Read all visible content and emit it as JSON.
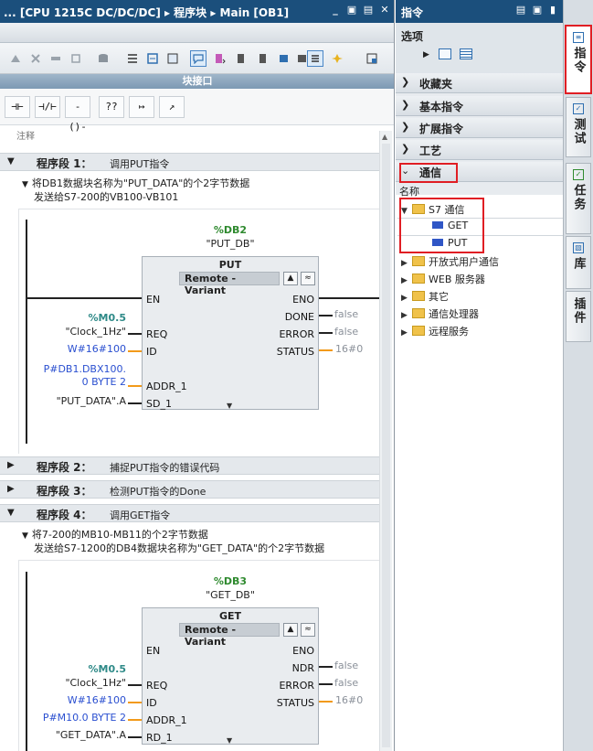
{
  "editor": {
    "title": "... [CPU 1215C DC/DC/DC] ▸ 程序块 ▸ Main [OB1]",
    "interface_label": "块接口",
    "comment_label": "注释",
    "ladder_buttons": [
      "⊣⊢",
      "⊣/⊢",
      "-()-",
      "??",
      "↦",
      "↗"
    ],
    "networks": [
      {
        "num": "程序段 1：",
        "title": "调用PUT指令",
        "expanded": true,
        "comment_line1": "将DB1数据块名称为\"PUT_DATA\"的个2字节数据",
        "comment_line2": "发送给S7-200的VB100-VB101"
      },
      {
        "num": "程序段 2：",
        "title": "捕捉PUT指令的错误代码",
        "expanded": false
      },
      {
        "num": "程序段 3：",
        "title": "检测PUT指令的Done",
        "expanded": false
      },
      {
        "num": "程序段 4：",
        "title": "调用GET指令",
        "expanded": true,
        "comment_line1": "将7-200的MB10-MB11的个2字节数据",
        "comment_line2": "发送给S7-1200的DB4数据块名称为\"GET_DATA\"的个2字节数据"
      }
    ],
    "put_block": {
      "db": "%DB2",
      "instance": "\"PUT_DB\"",
      "name": "PUT",
      "variant": "Remote - Variant",
      "pins_left": [
        "EN",
        "REQ",
        "ID",
        "ADDR_1",
        "SD_1"
      ],
      "pins_right": [
        "ENO",
        "DONE",
        "ERROR",
        "STATUS"
      ],
      "req_addr": "%M0.5",
      "req_tag": "\"Clock_1Hz\"",
      "id_val": "W#16#100",
      "addr_line1": "P#DB1.DBX100.",
      "addr_line2": "0 BYTE 2",
      "sd_val": "\"PUT_DATA\".A",
      "done_val": "false",
      "error_val": "false",
      "status_val": "16#0"
    },
    "get_block": {
      "db": "%DB3",
      "instance": "\"GET_DB\"",
      "name": "GET",
      "variant": "Remote - Variant",
      "pins_left": [
        "EN",
        "REQ",
        "ID",
        "ADDR_1",
        "RD_1"
      ],
      "pins_right": [
        "ENO",
        "NDR",
        "ERROR",
        "STATUS"
      ],
      "req_addr": "%M0.5",
      "req_tag": "\"Clock_1Hz\"",
      "id_val": "W#16#100",
      "addr_val": "P#M10.0 BYTE 2",
      "rd_val": "\"GET_DATA\".A",
      "ndr_val": "false",
      "error_val": "false",
      "status_val": "16#0"
    }
  },
  "instructions": {
    "title": "指令",
    "options_label": "选项",
    "sections": [
      "收藏夹",
      "基本指令",
      "扩展指令",
      "工艺",
      "通信"
    ],
    "tree_header": "名称",
    "tree": {
      "s7": "S7 通信",
      "get": "GET",
      "put": "PUT",
      "others": [
        "开放式用户通信",
        "WEB 服务器",
        "其它",
        "通信处理器",
        "远程服务"
      ]
    }
  },
  "side_tabs": [
    "指令",
    "测试",
    "任务",
    "库",
    "插件"
  ],
  "colors": {
    "titlebar": "#1b4f7c",
    "highlight": "#e01e24",
    "tag_blue": "#2a4fd0",
    "db_green": "#2f8a2f",
    "wire_orange": "#f29a1a"
  }
}
